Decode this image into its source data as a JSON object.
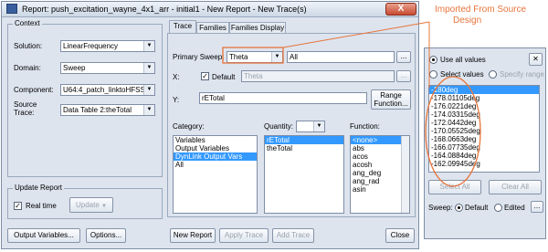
{
  "window": {
    "title": "Report: push_excitation_wayne_4x1_arr - initial1 - New Report - New Trace(s)",
    "close": "X"
  },
  "context": {
    "label": "Context",
    "solution_label": "Solution:",
    "solution_value": "LinearFrequency",
    "domain_label": "Domain:",
    "domain_value": "Sweep",
    "component_label": "Component:",
    "component_value": "U64:4_patch_linktoHFSS",
    "source_trace_label": "Source Trace:",
    "source_trace_value": "Data Table 2:theTotal"
  },
  "update_report": {
    "label": "Update Report",
    "realtime_label": "Real time",
    "update_btn": "Update"
  },
  "tabs": [
    "Trace",
    "Families",
    "Families Display"
  ],
  "trace": {
    "primary_sweep_label": "Primary Sweep:",
    "primary_sweep_value": "Theta",
    "primary_sweep_range": "All",
    "x_label": "X:",
    "default_label": "Default",
    "x_value": "Theta",
    "y_label": "Y:",
    "y_value": "rETotal",
    "range_function_btn": "Range Function...",
    "category_label": "Category:",
    "categories": [
      "Variables",
      "Output Variables",
      "DynLink Output Vars",
      "All"
    ],
    "category_selected": 2,
    "quantity_label": "Quantity:",
    "quantities": [
      "rETotal",
      "theTotal"
    ],
    "quantity_selected": 0,
    "function_label": "Function:",
    "functions": [
      "<none>",
      "abs",
      "acos",
      "acosh",
      "ang_deg",
      "ang_rad",
      "asin"
    ],
    "function_selected": 0
  },
  "bottom": {
    "output_variables": "Output Variables...",
    "options": "Options...",
    "new_report": "New Report",
    "apply_trace": "Apply Trace",
    "add_trace": "Add Trace",
    "close": "Close"
  },
  "values_panel": {
    "use_all": "Use all values",
    "select_values": "Select values",
    "specify_range": "Specify range",
    "values": [
      "-180deg",
      "-178.01105deg",
      "-176.0221deg",
      "-174.03315deg",
      "-172.0442deg",
      "-170.05525deg",
      "-168.0663deg",
      "-166.07735deg",
      "-164.0884deg",
      "-162.09945deg"
    ],
    "value_selected": 0,
    "select_all": "Select All",
    "clear_all": "Clear All",
    "sweep_label": "Sweep:",
    "default_label": "Default",
    "edited_label": "Edited"
  },
  "annotation": {
    "text_line1": "Imported From Source",
    "text_line2": "Design",
    "color": "#e8743b"
  }
}
